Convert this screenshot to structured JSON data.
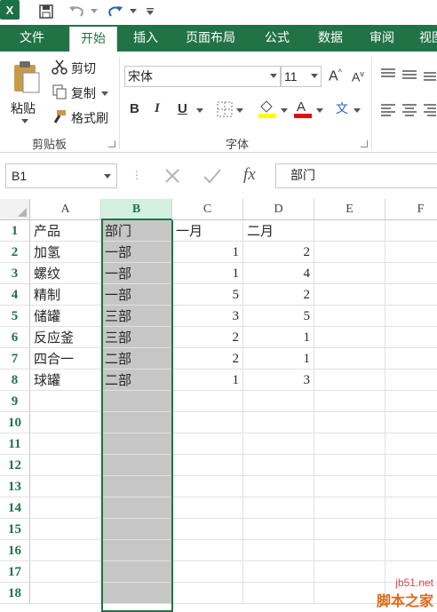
{
  "app": {
    "logo_letter": "X",
    "accent": "#217346"
  },
  "tabs": [
    {
      "label": "文件"
    },
    {
      "label": "开始"
    },
    {
      "label": "插入"
    },
    {
      "label": "页面布局"
    },
    {
      "label": "公式"
    },
    {
      "label": "数据"
    },
    {
      "label": "审阅"
    },
    {
      "label": "视图"
    }
  ],
  "ribbon": {
    "clipboard": {
      "paste": "粘贴",
      "cut": "剪切",
      "copy": "复制",
      "format_painter": "格式刷",
      "group_label": "剪贴板"
    },
    "font": {
      "font_name": "宋体",
      "font_size": "11",
      "bold": "B",
      "italic": "I",
      "underline": "U",
      "grow": "A",
      "shrink": "A",
      "phonetic": "文",
      "group_label": "字体"
    }
  },
  "formula_bar": {
    "name_box": "B1",
    "fx": "fx",
    "content": "部门"
  },
  "sheet": {
    "columns": [
      "A",
      "B",
      "C",
      "D",
      "E",
      "F"
    ],
    "selected_column": "B",
    "rows": [
      "1",
      "2",
      "3",
      "4",
      "5",
      "6",
      "7",
      "8",
      "9",
      "10",
      "11",
      "12",
      "13",
      "14",
      "15",
      "16",
      "17",
      "18"
    ],
    "cells": [
      [
        "产品",
        "部门",
        "一月",
        "二月",
        "",
        ""
      ],
      [
        "加氢",
        "一部",
        "1",
        "2",
        "",
        ""
      ],
      [
        "螺纹",
        "一部",
        "1",
        "4",
        "",
        ""
      ],
      [
        "精制",
        "一部",
        "5",
        "2",
        "",
        ""
      ],
      [
        "储罐",
        "三部",
        "3",
        "5",
        "",
        ""
      ],
      [
        "反应釜",
        "三部",
        "2",
        "1",
        "",
        ""
      ],
      [
        "四合一",
        "二部",
        "2",
        "1",
        "",
        ""
      ],
      [
        "球罐",
        "二部",
        "1",
        "3",
        "",
        ""
      ]
    ]
  },
  "watermark": {
    "site": "jb51.net",
    "name": "脚本之家"
  }
}
